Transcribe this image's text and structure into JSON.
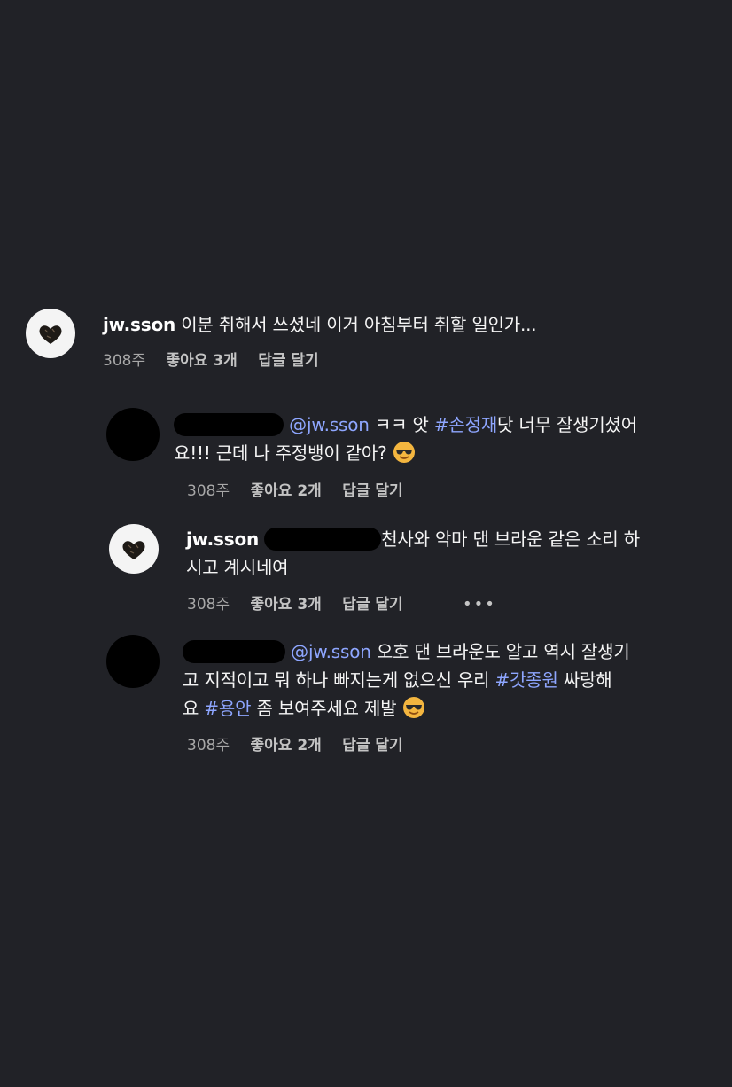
{
  "comments": [
    {
      "username": "jw.sson",
      "text": "이분 취해서 쓰셨네 이거 아침부터 취할 일인가...",
      "time": "308주",
      "likes": "좋아요 3개",
      "reply": "답글 달기"
    },
    {
      "mention": "@jw.sson",
      "text_a": "ㅋㅋ 앗",
      "hashtag": "#손정재",
      "text_b": "닷 너무 잘생기셨어",
      "text_c": "요!!! 근데 나 주정뱅이 같아?",
      "emoji": "smiling-face-with-sunglasses",
      "time": "308주",
      "likes": "좋아요 2개",
      "reply": "답글 달기"
    },
    {
      "username": "jw.sson",
      "text_a": "천사와 악마 댄 브라운 같은 소리 하",
      "text_b": "시고 계시네여",
      "time": "308주",
      "likes": "좋아요 3개",
      "reply": "답글 달기",
      "more": "•••"
    },
    {
      "mention": "@jw.sson",
      "text_a": "오호 댄 브라운도 알고 역시 잘생기",
      "text_b": "고 지적이고 뭐 하나 빠지는게 없으신 우리",
      "hashtag_a": "#갓종원",
      "text_c": "싸랑해",
      "text_d": "요",
      "hashtag_b": "#용안",
      "text_e": "좀 보여주세요 제발",
      "emoji": "smiling-face-with-sunglasses",
      "time": "308주",
      "likes": "좋아요 2개",
      "reply": "답글 달기"
    }
  ]
}
